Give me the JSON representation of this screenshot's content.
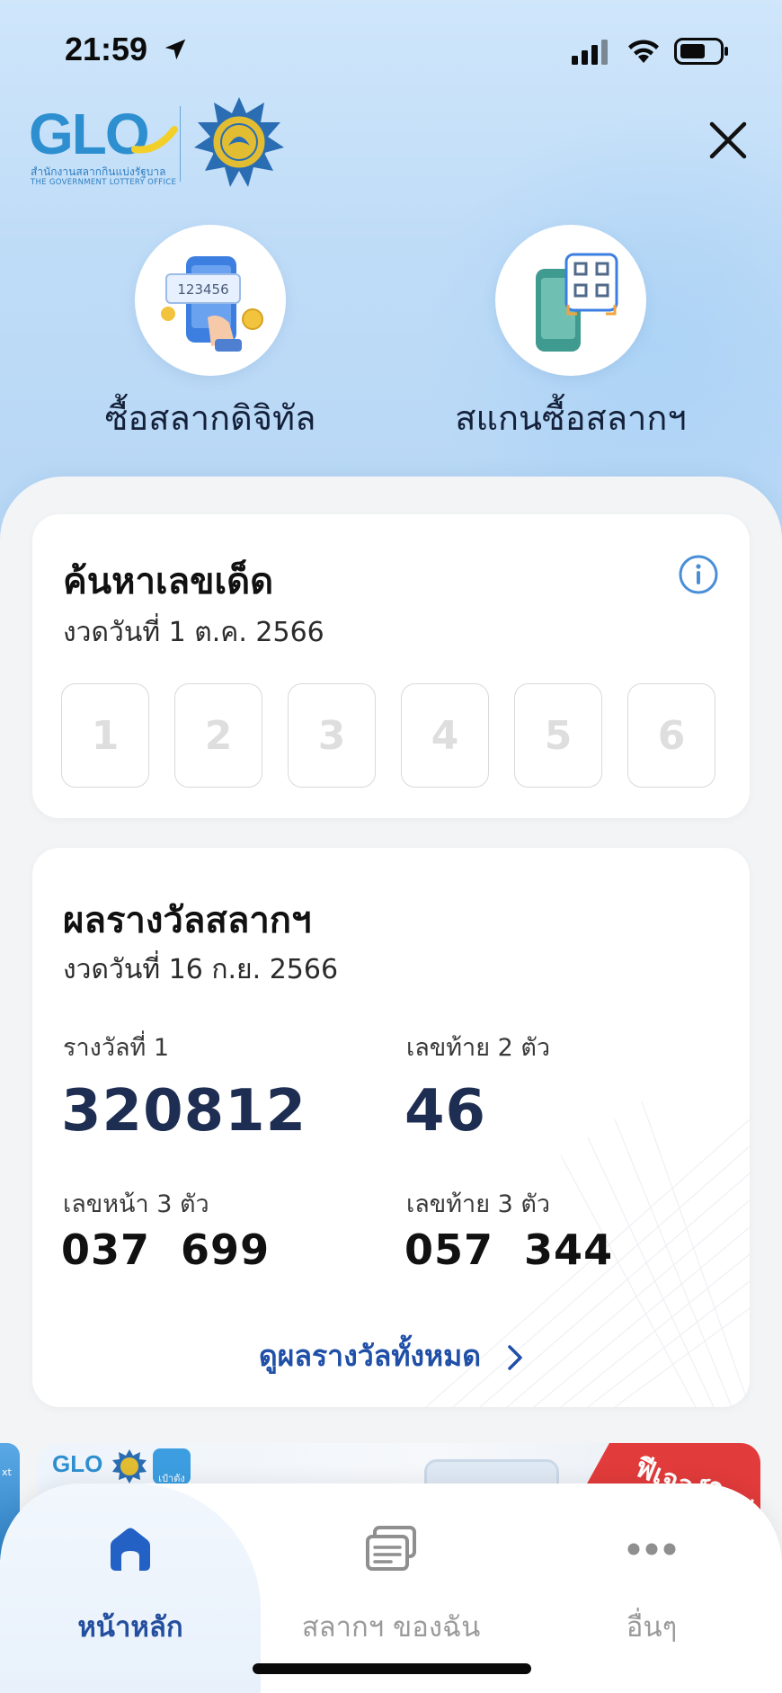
{
  "status_bar": {
    "time": "21:59"
  },
  "logo": {
    "text": "GLO",
    "subtitle_th": "สำนักงานสลากกินแบ่งรัฐบาล",
    "subtitle_en": "THE GOVERNMENT LOTTERY OFFICE"
  },
  "quick_actions": [
    {
      "label": "ซื้อสลากดิจิทัล",
      "icon": "digital-lottery-icon",
      "ticket_number": "123456"
    },
    {
      "label": "สแกนซื้อสลากฯ",
      "icon": "qr-scan-icon"
    }
  ],
  "search": {
    "title": "ค้นหาเลขเด็ด",
    "date": "งวดวันที่  1 ต.ค. 2566",
    "digit_placeholders": [
      "1",
      "2",
      "3",
      "4",
      "5",
      "6"
    ]
  },
  "results": {
    "title": "ผลรางวัลสลากฯ",
    "date": "งวดวันที่  16 ก.ย. 2566",
    "first_prize_label": "รางวัลที่ 1",
    "first_prize": "320812",
    "last2_label": "เลขท้าย 2 ตัว",
    "last2": "46",
    "front3_label": "เลขหน้า 3 ตัว",
    "front3": "037  699",
    "last3_label": "เลขท้าย 3 ตัว",
    "last3": "057  344",
    "see_all": "ดูผลรางวัลทั้งหมด"
  },
  "banner": {
    "logo": "GLO",
    "app_label": "เป๋าตัง",
    "ribbon": "ฟีเจอร์ใหม่",
    "peek_text": "xt"
  },
  "tabbar": {
    "home": "หน้าหลัก",
    "mine": "สลากฯ ของฉัน",
    "more": "อื่นๆ"
  },
  "colors": {
    "accent": "#244f9e",
    "number": "#1e2e52",
    "hero_bg": "#c4dff8",
    "ribbon": "#e23b3b"
  }
}
